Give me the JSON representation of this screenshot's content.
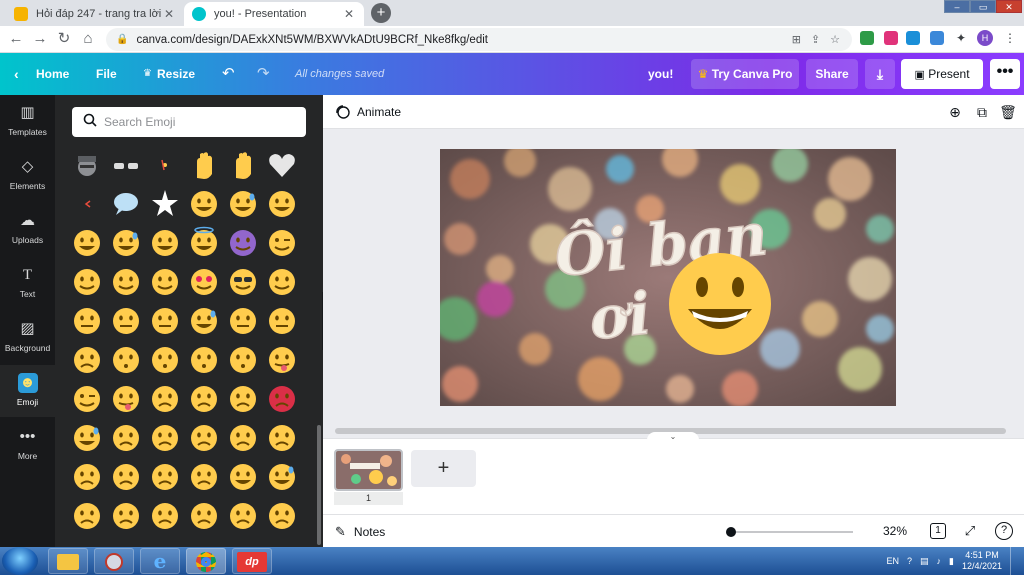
{
  "browser": {
    "tabs": [
      {
        "title": "Hỏi đáp 247 - trang tra lời",
        "active": false,
        "favicon_color": "#f6b300"
      },
      {
        "title": "you! - Presentation",
        "active": true,
        "favicon_color": "#00c4cc"
      }
    ],
    "new_tab_label": "+",
    "url": "canva.com/design/DAExkXNt5WM/BXWVkADtU9BCRf_Nke8fkg/edit",
    "profile_initial": "H"
  },
  "canva_header": {
    "home_label": "Home",
    "file_label": "File",
    "resize_label": "Resize",
    "status": "All changes saved",
    "design_title": "you!",
    "try_pro_label": "Try Canva Pro",
    "share_label": "Share",
    "present_label": "Present"
  },
  "sidebar": {
    "items": [
      {
        "label": "Templates",
        "icon": "templates-icon"
      },
      {
        "label": "Elements",
        "icon": "elements-icon"
      },
      {
        "label": "Uploads",
        "icon": "uploads-icon"
      },
      {
        "label": "Text",
        "icon": "text-icon"
      },
      {
        "label": "Background",
        "icon": "background-icon"
      },
      {
        "label": "Emoji",
        "icon": "emoji-icon",
        "active": true
      },
      {
        "label": "More",
        "icon": "more-icon"
      }
    ]
  },
  "emoji_panel": {
    "search_placeholder": "Search Emoji"
  },
  "editor": {
    "animate_label": "Animate",
    "canvas_text_line1": "Ôi bạn",
    "canvas_text_line2": "ơi"
  },
  "pages": {
    "page_number": "1",
    "add_page_label": "+"
  },
  "footer": {
    "notes_label": "Notes",
    "zoom": "32%",
    "zoom_fraction": 0.32,
    "page_count": "1"
  },
  "taskbar": {
    "language": "EN",
    "time": "4:51 PM",
    "date": "12/4/2021"
  },
  "colors": {
    "canva_gradient_start": "#00c4cc",
    "canva_gradient_end": "#8b3dff",
    "panel_bg": "#252627",
    "rail_bg": "#18191b",
    "emoji_yellow": "#ffcc4d"
  }
}
